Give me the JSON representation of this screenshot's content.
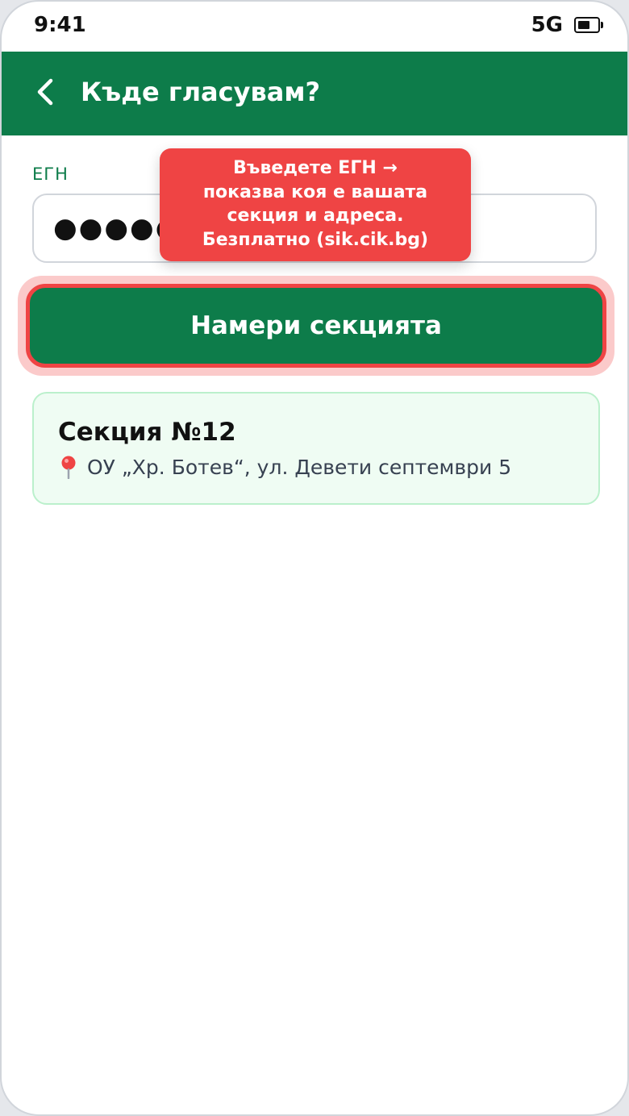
{
  "status_bar": {
    "time": "9:41",
    "network": "5G",
    "battery_icon": "battery-icon"
  },
  "header": {
    "title": "Къде гласувам?",
    "back_icon": "chevron-left-icon"
  },
  "form": {
    "egn_label": "ЕГН",
    "egn_value": "●●●●●",
    "find_button_label": "Намери секцията"
  },
  "tooltip": {
    "text": "Въведете ЕГН →\nпоказва коя е вашата\nсекция и адреса.\nБезплатно (sik.cik.bg)"
  },
  "result": {
    "title": "Секция №12",
    "address": "ОУ „Хр. Ботев“, ул. Девети септември 5",
    "pin_icon": "map-pin-icon"
  },
  "colors": {
    "brand_green": "#0d7c4a",
    "highlight_red": "#ef4444",
    "card_background": "#effcf3"
  }
}
